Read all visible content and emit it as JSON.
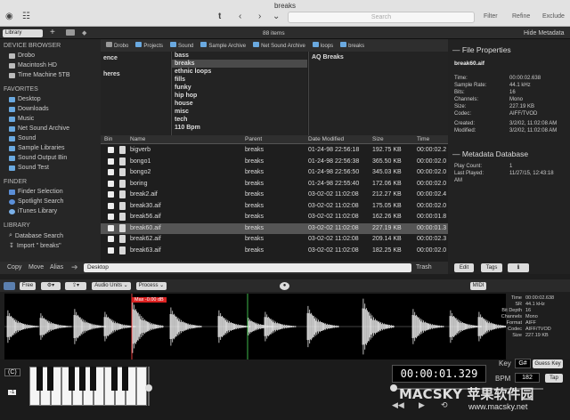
{
  "title": "breaks",
  "toolbar": {
    "search_placeholder": "Search",
    "filter": "Filter",
    "refine": "Refine",
    "exclude": "Exclude"
  },
  "bar2": {
    "library": "Library",
    "items": "88 items",
    "hide_metadata": "Hide Metadata"
  },
  "sidebar": {
    "device_header": "DEVICE BROWSER",
    "devices": [
      "Drobo",
      "Macintosh HD",
      "Time Machine 5TB"
    ],
    "favorites_header": "FAVORITES",
    "favorites": [
      "Desktop",
      "Downloads",
      "Music",
      "Net Sound Archive",
      "Sound",
      "Sample Libraries",
      "Sound Output Bin",
      "Sound Test"
    ],
    "finder_header": "FINDER",
    "finder": [
      "Finder Selection",
      "Spotlight Search",
      "iTunes Library"
    ],
    "library_header": "LIBRARY",
    "library": [
      "Database Search",
      "Import \" breaks\""
    ]
  },
  "path": [
    "Drobo",
    "Projects",
    "Sound",
    "Sample Archive",
    "Net Sound Archive",
    "loops",
    "breaks"
  ],
  "columns": {
    "col1": [
      "ence",
      "heres"
    ],
    "col2": [
      "bass",
      "breaks",
      "ethnic loops",
      "fills",
      "funky",
      "hip hop",
      "house",
      "misc",
      "tech",
      "110 Bpm"
    ],
    "col3": [
      "AQ Breaks"
    ]
  },
  "file_headers": [
    "Bin",
    "Name",
    "Parent",
    "Date Modified",
    "Size",
    "Time"
  ],
  "files": [
    {
      "name": "bigverb",
      "parent": "breaks",
      "date": "01-24-98 22:56:18",
      "size": "192.75 KB",
      "time": "00:00:02.2"
    },
    {
      "name": "bongo1",
      "parent": "breaks",
      "date": "01-24-98 22:56:38",
      "size": "365.50 KB",
      "time": "00:00:02.0"
    },
    {
      "name": "bongo2",
      "parent": "breaks",
      "date": "01-24-98 22:56:50",
      "size": "345.03 KB",
      "time": "00:00:02.0"
    },
    {
      "name": "boring",
      "parent": "breaks",
      "date": "01-24-98 22:55:40",
      "size": "172.06 KB",
      "time": "00:00:02.0"
    },
    {
      "name": "break2.aif",
      "parent": "breaks",
      "date": "03-02-02 11:02:08",
      "size": "212.27 KB",
      "time": "00:00:02.4"
    },
    {
      "name": "break30.aif",
      "parent": "breaks",
      "date": "03-02-02 11:02:08",
      "size": "175.05 KB",
      "time": "00:00:02.0"
    },
    {
      "name": "break56.aif",
      "parent": "breaks",
      "date": "03-02-02 11:02:08",
      "size": "162.26 KB",
      "time": "00:00:01.8"
    },
    {
      "name": "break60.aif",
      "parent": "breaks",
      "date": "03-02-02 11:02:08",
      "size": "227.19 KB",
      "time": "00:00:01.3"
    },
    {
      "name": "break62.aif",
      "parent": "breaks",
      "date": "03-02-02 11:02:08",
      "size": "209.14 KB",
      "time": "00:00:02.3"
    },
    {
      "name": "break63.aif",
      "parent": "breaks",
      "date": "03-02-02 11:02:08",
      "size": "182.25 KB",
      "time": "00:00:02.0"
    }
  ],
  "selected_index": 7,
  "bottom_bar": {
    "copy": "Copy",
    "move": "Move",
    "alias": "Alias",
    "destination": "Desktop",
    "trash": "Trash",
    "edit": "Edit",
    "tags": "Tags"
  },
  "properties": {
    "header": "File Properties",
    "filename": "break60.aif",
    "rows": [
      [
        "Time:",
        "00:00:02.638"
      ],
      [
        "Sample Rate:",
        "44.1 kHz"
      ],
      [
        "Bits:",
        "16"
      ],
      [
        "Channels:",
        "Mono"
      ],
      [
        "Size:",
        "227.19 KB"
      ],
      [
        "Codec:",
        "AIFF/TVOD"
      ]
    ],
    "rows2": [
      [
        "Created:",
        "3/2/02, 11:02:08 AM"
      ],
      [
        "Modified:",
        "3/2/02, 11:02:08 AM"
      ]
    ]
  },
  "metadata": {
    "header": "Metadata Database",
    "rows": [
      [
        "Play Count:",
        "1"
      ],
      [
        "Last Played:",
        "11/27/15, 12:43:18"
      ],
      [
        "AM",
        ""
      ]
    ]
  },
  "wave_toolbar": {
    "free": "Free",
    "audio_units": "Audio Units",
    "process": "Process",
    "midi": "MIDI"
  },
  "wave": {
    "max_label": "Max -0.00 dB"
  },
  "wave_info": [
    [
      "Time",
      "00:00:02.638"
    ],
    [
      "SR",
      "44.1 kHz"
    ],
    [
      "Bit Depth",
      "16"
    ],
    [
      "Channels",
      "Mono"
    ],
    [
      "Format",
      "AIFF"
    ],
    [
      "Codec",
      "AIFF/TVOD"
    ],
    [
      "Size",
      "227.19 KB"
    ]
  ],
  "transport": {
    "octave": "(C)",
    "minus": "-1",
    "counter": "00:00:01.329",
    "key_label": "Key",
    "key": "G#",
    "guess_key": "Guess Key",
    "bpm_label": "BPM",
    "bpm": "182",
    "tap": "Tap"
  },
  "watermark": {
    "title": "MACSKY 苹果软件园",
    "url": "www.macsky.net"
  }
}
